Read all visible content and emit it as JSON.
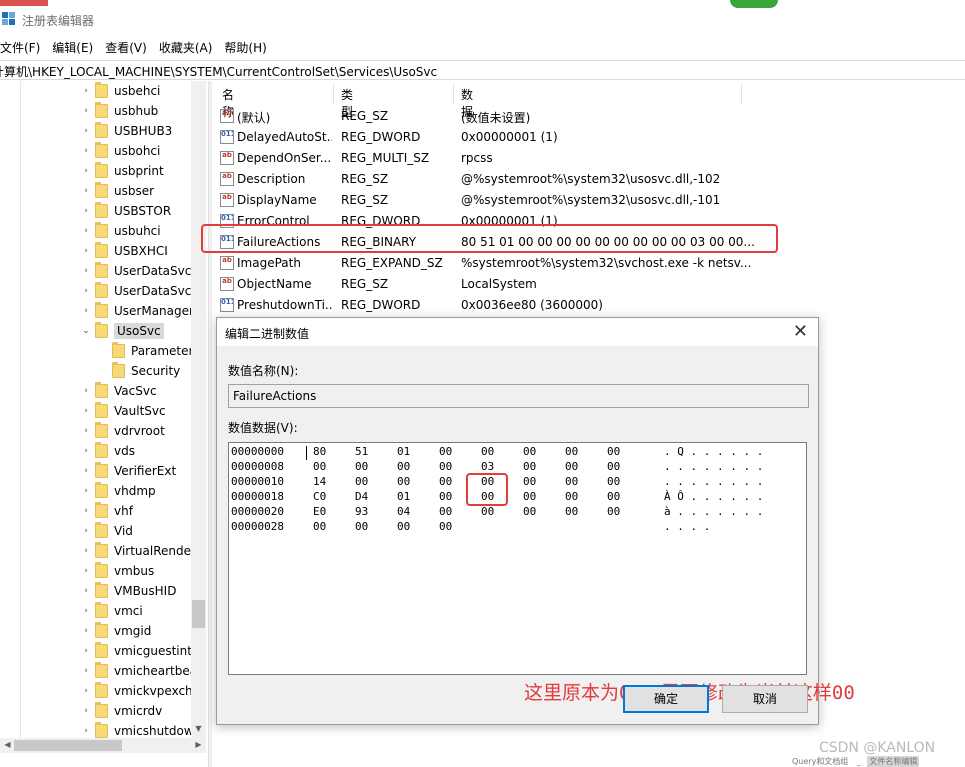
{
  "window": {
    "title": "注册表编辑器"
  },
  "menu": [
    "文件(F)",
    "编辑(E)",
    "查看(V)",
    "收藏夹(A)",
    "帮助(H)"
  ],
  "address": "计算机\\HKEY_LOCAL_MACHINE\\SYSTEM\\CurrentControlSet\\Services\\UsoSvc",
  "tree": [
    {
      "label": "usbehci",
      "expanded": false
    },
    {
      "label": "usbhub",
      "expanded": false
    },
    {
      "label": "USBHUB3",
      "expanded": false
    },
    {
      "label": "usbohci",
      "expanded": false
    },
    {
      "label": "usbprint",
      "expanded": false
    },
    {
      "label": "usbser",
      "expanded": false
    },
    {
      "label": "USBSTOR",
      "expanded": false
    },
    {
      "label": "usbuhci",
      "expanded": false
    },
    {
      "label": "USBXHCI",
      "expanded": false
    },
    {
      "label": "UserDataSvc",
      "expanded": false
    },
    {
      "label": "UserDataSvc_",
      "expanded": false
    },
    {
      "label": "UserManager",
      "expanded": false
    },
    {
      "label": "UsoSvc",
      "expanded": true,
      "selected": true
    },
    {
      "label": "Parameters",
      "child": true
    },
    {
      "label": "Security",
      "child": true
    },
    {
      "label": "VacSvc",
      "expanded": false
    },
    {
      "label": "VaultSvc",
      "expanded": false
    },
    {
      "label": "vdrvroot",
      "expanded": false
    },
    {
      "label": "vds",
      "expanded": false
    },
    {
      "label": "VerifierExt",
      "expanded": false
    },
    {
      "label": "vhdmp",
      "expanded": false
    },
    {
      "label": "vhf",
      "expanded": false
    },
    {
      "label": "Vid",
      "expanded": false
    },
    {
      "label": "VirtualRender",
      "expanded": false
    },
    {
      "label": "vmbus",
      "expanded": false
    },
    {
      "label": "VMBusHID",
      "expanded": false
    },
    {
      "label": "vmci",
      "expanded": false
    },
    {
      "label": "vmgid",
      "expanded": false
    },
    {
      "label": "vmicguestinterface",
      "expanded": false
    },
    {
      "label": "vmicheartbeat",
      "expanded": false
    },
    {
      "label": "vmickvpexchange",
      "expanded": false
    },
    {
      "label": "vmicrdv",
      "expanded": false
    },
    {
      "label": "vmicshutdown",
      "expanded": false
    }
  ],
  "list": {
    "headers": [
      "名称",
      "类型",
      "数据"
    ],
    "rows": [
      {
        "icon": "ab",
        "name": "(默认)",
        "type": "REG_SZ",
        "data": "(数值未设置)"
      },
      {
        "icon": "bin",
        "name": "DelayedAutoSt...",
        "type": "REG_DWORD",
        "data": "0x00000001 (1)"
      },
      {
        "icon": "ab",
        "name": "DependOnSer...",
        "type": "REG_MULTI_SZ",
        "data": "rpcss"
      },
      {
        "icon": "ab",
        "name": "Description",
        "type": "REG_SZ",
        "data": "@%systemroot%\\system32\\usosvc.dll,-102"
      },
      {
        "icon": "ab",
        "name": "DisplayName",
        "type": "REG_SZ",
        "data": "@%systemroot%\\system32\\usosvc.dll,-101"
      },
      {
        "icon": "bin",
        "name": "ErrorControl",
        "type": "REG_DWORD",
        "data": "0x00000001 (1)"
      },
      {
        "icon": "bin",
        "name": "FailureActions",
        "type": "REG_BINARY",
        "data": "80 51 01 00 00 00 00 00 00 00 00 00 03 00 00..."
      },
      {
        "icon": "ab",
        "name": "ImagePath",
        "type": "REG_EXPAND_SZ",
        "data": "%systemroot%\\system32\\svchost.exe -k netsv..."
      },
      {
        "icon": "ab",
        "name": "ObjectName",
        "type": "REG_SZ",
        "data": "LocalSystem"
      },
      {
        "icon": "bin",
        "name": "PreshutdownTi...",
        "type": "REG_DWORD",
        "data": "0x0036ee80 (3600000)"
      }
    ]
  },
  "dialog": {
    "title": "编辑二进制数值",
    "name_label": "数值名称(N):",
    "name_value": "FailureActions",
    "data_label": "数值数据(V):",
    "hex_rows": [
      {
        "offset": "00000000",
        "bytes": [
          "80",
          "51",
          "01",
          "00",
          "00",
          "00",
          "00",
          "00"
        ],
        "ascii": ". Q . . . . . ."
      },
      {
        "offset": "00000008",
        "bytes": [
          "00",
          "00",
          "00",
          "00",
          "03",
          "00",
          "00",
          "00"
        ],
        "ascii": ". . . . . . . ."
      },
      {
        "offset": "00000010",
        "bytes": [
          "14",
          "00",
          "00",
          "00",
          "00",
          "00",
          "00",
          "00"
        ],
        "ascii": ". . . . . . . ."
      },
      {
        "offset": "00000018",
        "bytes": [
          "C0",
          "D4",
          "01",
          "00",
          "00",
          "00",
          "00",
          "00"
        ],
        "ascii": "À Ô . . . . . ."
      },
      {
        "offset": "00000020",
        "bytes": [
          "E0",
          "93",
          "04",
          "00",
          "00",
          "00",
          "00",
          "00"
        ],
        "ascii": "à . . . . . . ."
      },
      {
        "offset": "00000028",
        "bytes": [
          "00",
          "00",
          "00",
          "00"
        ],
        "ascii": ". . . ."
      }
    ],
    "annotation": "这里原本为01，需要修改为当前这样00",
    "ok_label": "确定",
    "cancel_label": "取消"
  },
  "watermark": "CSDN @KANLON",
  "taskbar_labels": [
    "Query和文档组",
    "_",
    "文件名称编辑"
  ],
  "colors": {
    "highlight": "#e23b3b",
    "folder": "#f8d978",
    "accent": "#0078d7"
  }
}
